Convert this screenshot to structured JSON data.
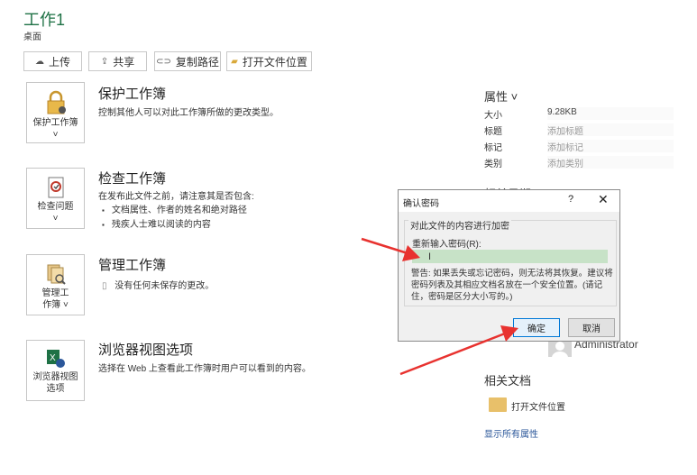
{
  "workbook": {
    "title": "工作1",
    "location": "桌面"
  },
  "toolbar": {
    "upload_label": "上传",
    "share_label": "共享",
    "copy_path_label": "复制路径",
    "open_location_label": "打开文件位置"
  },
  "sections": {
    "protect": {
      "tile_label": "保护工作簿",
      "tile_caret": "˅",
      "title": "保护工作簿",
      "desc": "控制其他人可以对此工作簿所做的更改类型。"
    },
    "inspect": {
      "tile_label": "检查问题",
      "tile_caret": "˅",
      "title": "检查工作簿",
      "desc": "在发布此文件之前，请注意其是否包含:",
      "bullets": [
        "文档属性、作者的姓名和绝对路径",
        "残疾人士难以阅读的内容"
      ]
    },
    "manage": {
      "tile_label_1": "管理工",
      "tile_label_2": "作簿 ˅",
      "title": "管理工作簿",
      "desc": "没有任何未保存的更改。"
    },
    "browser": {
      "tile_label_1": "浏览器视图",
      "tile_label_2": "选项",
      "title": "浏览器视图选项",
      "desc": "选择在 Web 上查看此工作簿时用户可以看到的内容。"
    }
  },
  "properties": {
    "heading": "属性 ˅",
    "rows": [
      {
        "key": "大小",
        "value": "9.28KB"
      },
      {
        "key": "标题",
        "value": "添加标题"
      },
      {
        "key": "标记",
        "value": "添加标记"
      },
      {
        "key": "类别",
        "value": "添加类别"
      }
    ],
    "related_dates_heading": "相关日期",
    "author": "Administrator"
  },
  "related_docs": {
    "heading": "相关文档",
    "open_location": "打开文件位置",
    "show_all": "显示所有属性"
  },
  "dialog": {
    "title": "确认密码",
    "help": "?",
    "close": "✕",
    "group_label": "对此文件的内容进行加密",
    "password_label": "重新输入密码(R):",
    "password_value": "",
    "warning": "警告: 如果丢失或忘记密码，则无法将其恢复。建议将密码列表及其相应文档名放在一个安全位置。(请记住，密码是区分大小写的。)",
    "ok_label": "确定",
    "cancel_label": "取消"
  },
  "colors": {
    "accent": "#1e7145",
    "link": "#2b579a",
    "arrow": "#e8322f",
    "input_fill": "#c7e2c7"
  }
}
